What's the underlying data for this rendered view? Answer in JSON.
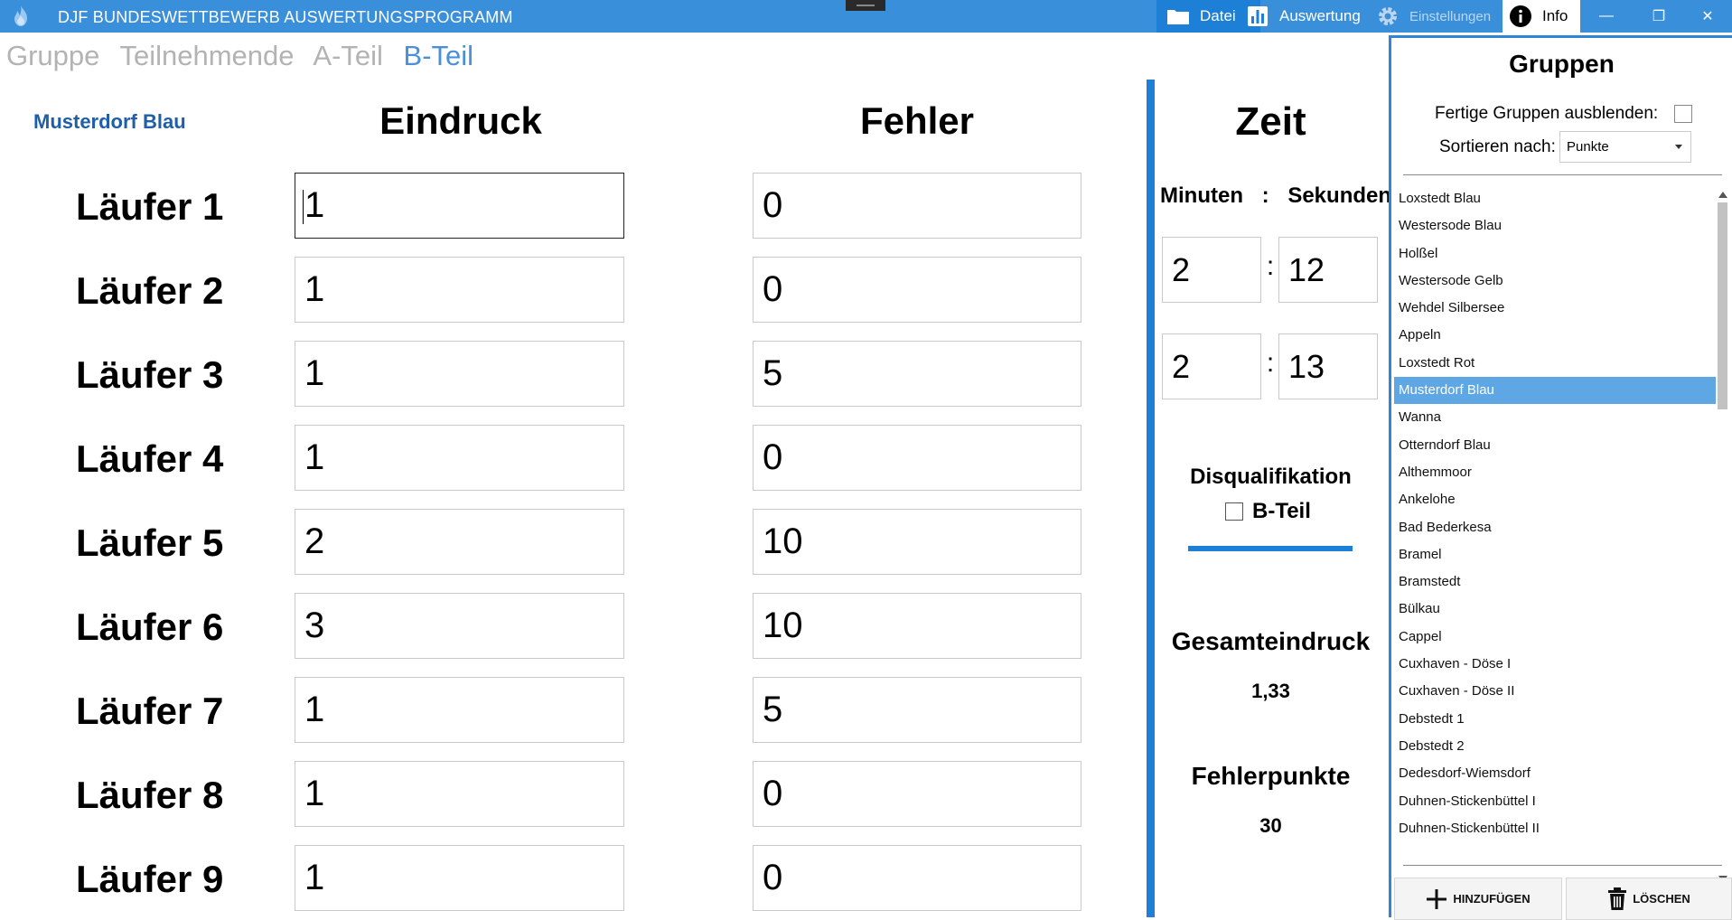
{
  "app": {
    "title": "DJF BUNDESWETTBEWERB AUSWERTUNGSPROGRAMM",
    "icon": "flame-icon"
  },
  "menu": {
    "datei": "Datei",
    "auswertung": "Auswertung",
    "einstellungen": "Einstellungen",
    "info": "Info"
  },
  "window_controls": {
    "minimize": "—",
    "maximize": "❐",
    "close": "✕"
  },
  "nav": {
    "tabs": [
      "Gruppe",
      "Teilnehmende",
      "A-Teil",
      "B-Teil"
    ],
    "active": "B-Teil"
  },
  "group": {
    "name": "Musterdorf Blau"
  },
  "columns": {
    "eindruck": "Eindruck",
    "fehler": "Fehler"
  },
  "runners": [
    {
      "label": "Läufer 1",
      "eindruck": "1",
      "fehler": "0"
    },
    {
      "label": "Läufer 2",
      "eindruck": "1",
      "fehler": "0"
    },
    {
      "label": "Läufer 3",
      "eindruck": "1",
      "fehler": "5"
    },
    {
      "label": "Läufer 4",
      "eindruck": "1",
      "fehler": "0"
    },
    {
      "label": "Läufer 5",
      "eindruck": "2",
      "fehler": "10"
    },
    {
      "label": "Läufer 6",
      "eindruck": "3",
      "fehler": "10"
    },
    {
      "label": "Läufer 7",
      "eindruck": "1",
      "fehler": "5"
    },
    {
      "label": "Läufer 8",
      "eindruck": "1",
      "fehler": "0"
    },
    {
      "label": "Läufer 9",
      "eindruck": "1",
      "fehler": "0"
    }
  ],
  "zeit": {
    "title": "Zeit",
    "minutes_label": "Minuten",
    "separator": ":",
    "seconds_label": "Sekunden",
    "time1": {
      "min": "2",
      "sec": "12"
    },
    "time2": {
      "min": "2",
      "sec": "13"
    }
  },
  "disqualifikation": {
    "title": "Disqualifikation",
    "checkbox_label": "B-Teil",
    "checked": false
  },
  "gesamteindruck": {
    "label": "Gesamteindruck",
    "value": "1,33"
  },
  "fehlerpunkte": {
    "label": "Fehlerpunkte",
    "value": "30"
  },
  "gruppen": {
    "title": "Gruppen",
    "hide_finished_label": "Fertige Gruppen ausblenden:",
    "hide_finished_checked": false,
    "sort_label": "Sortieren nach:",
    "sort_value": "Punkte",
    "items": [
      "Loxstedt Blau",
      "Westersode Blau",
      "Holßel",
      "Westersode Gelb",
      "Wehdel Silbersee",
      "Appeln",
      "Loxstedt Rot",
      "Musterdorf Blau",
      "Wanna",
      "Otterndorf Blau",
      "Althemmoor",
      "Ankelohe",
      "Bad Bederkesa",
      "Bramel",
      "Bramstedt",
      "Bülkau",
      "Cappel",
      "Cuxhaven - Döse I",
      "Cuxhaven - Döse II",
      "Debstedt 1",
      "Debstedt 2",
      "Dedesdorf-Wiemsdorf",
      "Duhnen-Stickenbüttel I",
      "Duhnen-Stickenbüttel II"
    ],
    "selected_index": 7,
    "add_label": "HINZUFÜGEN",
    "delete_label": "LÖSCHEN"
  },
  "colors": {
    "titlebar": "#3a8fdb",
    "accent": "#1e7fd6",
    "selection": "#5ea6e4",
    "group_name": "#1e5fa8"
  }
}
